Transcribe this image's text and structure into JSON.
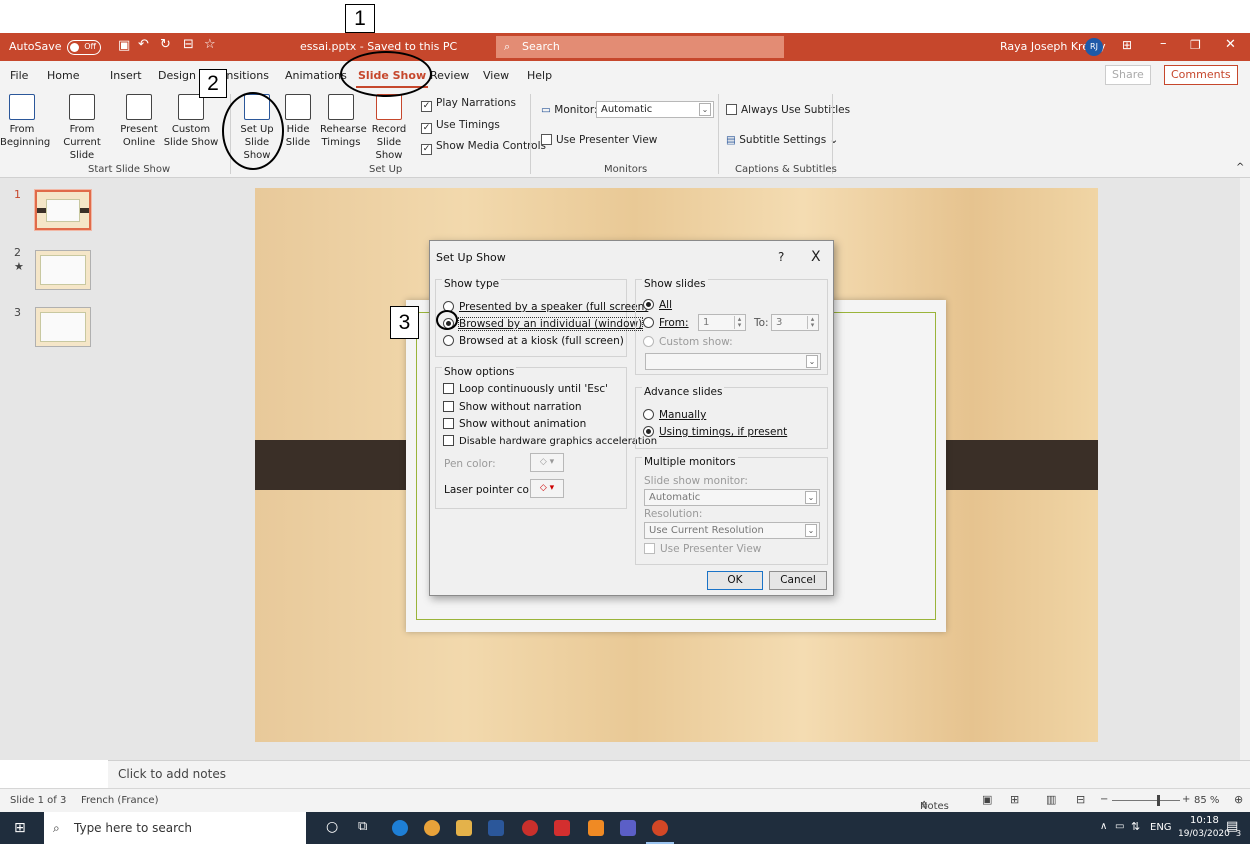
{
  "titlebar": {
    "autosave": "AutoSave",
    "autosave_state": "Off",
    "doc": "essai.pptx - Saved to this PC",
    "search": "Search",
    "user": "Raya Joseph Kreidy",
    "user_initials": "RJ"
  },
  "menu": {
    "items": [
      "File",
      "Home",
      "Insert",
      "Design",
      "Transitions",
      "Animations",
      "Slide Show",
      "Review",
      "View",
      "Help"
    ],
    "share": "Share",
    "comments": "Comments"
  },
  "ribbon": {
    "from_beginning": "From Beginning",
    "from_current": "From Current Slide",
    "present_online": "Present Online",
    "custom_show": "Custom Slide Show",
    "setup_show": "Set Up Slide Show",
    "hide_slide": "Hide Slide",
    "rehearse": "Rehearse Timings",
    "record": "Record Slide Show",
    "play_narrations": "Play Narrations",
    "use_timings": "Use Timings",
    "show_media": "Show Media Controls",
    "monitor_label": "Monitor:",
    "monitor_value": "Automatic",
    "use_presenter": "Use Presenter View",
    "always_subtitles": "Always Use Subtitles",
    "subtitle_settings": "Subtitle Settings",
    "groups": [
      "Start Slide Show",
      "Set Up",
      "Monitors",
      "Captions & Subtitles"
    ]
  },
  "annotations": [
    "1",
    "2",
    "3"
  ],
  "slides": {
    "numbers": [
      "1",
      "2",
      "3"
    ],
    "star": "★"
  },
  "notes": "Click to add notes",
  "dialog": {
    "title": "Set Up Show",
    "help": "?",
    "close": "X",
    "show_type": "Show type",
    "type_speaker": "Presented by a speaker (full screen)",
    "type_individual": "Browsed by an individual (window)",
    "type_kiosk": "Browsed at a kiosk (full screen)",
    "show_options": "Show options",
    "loop": "Loop continuously until 'Esc'",
    "no_narration": "Show without narration",
    "no_animation": "Show without animation",
    "disable_hw": "Disable hardware graphics acceleration",
    "pen_color": "Pen color:",
    "laser_color": "Laser pointer color:",
    "show_slides": "Show slides",
    "all": "All",
    "from": "From:",
    "from_value": "1",
    "to": "To:",
    "to_value": "3",
    "custom_show": "Custom show:",
    "advance": "Advance slides",
    "manually": "Manually",
    "using_timings": "Using timings, if present",
    "multi": "Multiple monitors",
    "slide_show_monitor": "Slide show monitor:",
    "monitor_value": "Automatic",
    "resolution": "Resolution:",
    "resolution_value": "Use Current Resolution",
    "use_presenter": "Use Presenter View",
    "ok": "OK",
    "cancel": "Cancel"
  },
  "status": {
    "slide": "Slide 1 of 3",
    "lang": "French (France)",
    "notes": "Notes",
    "zoom": "85 %"
  },
  "taskbar": {
    "search": "Type here to search",
    "lang": "ENG",
    "time": "10:18",
    "date": "19/03/2020",
    "notif": "3"
  }
}
